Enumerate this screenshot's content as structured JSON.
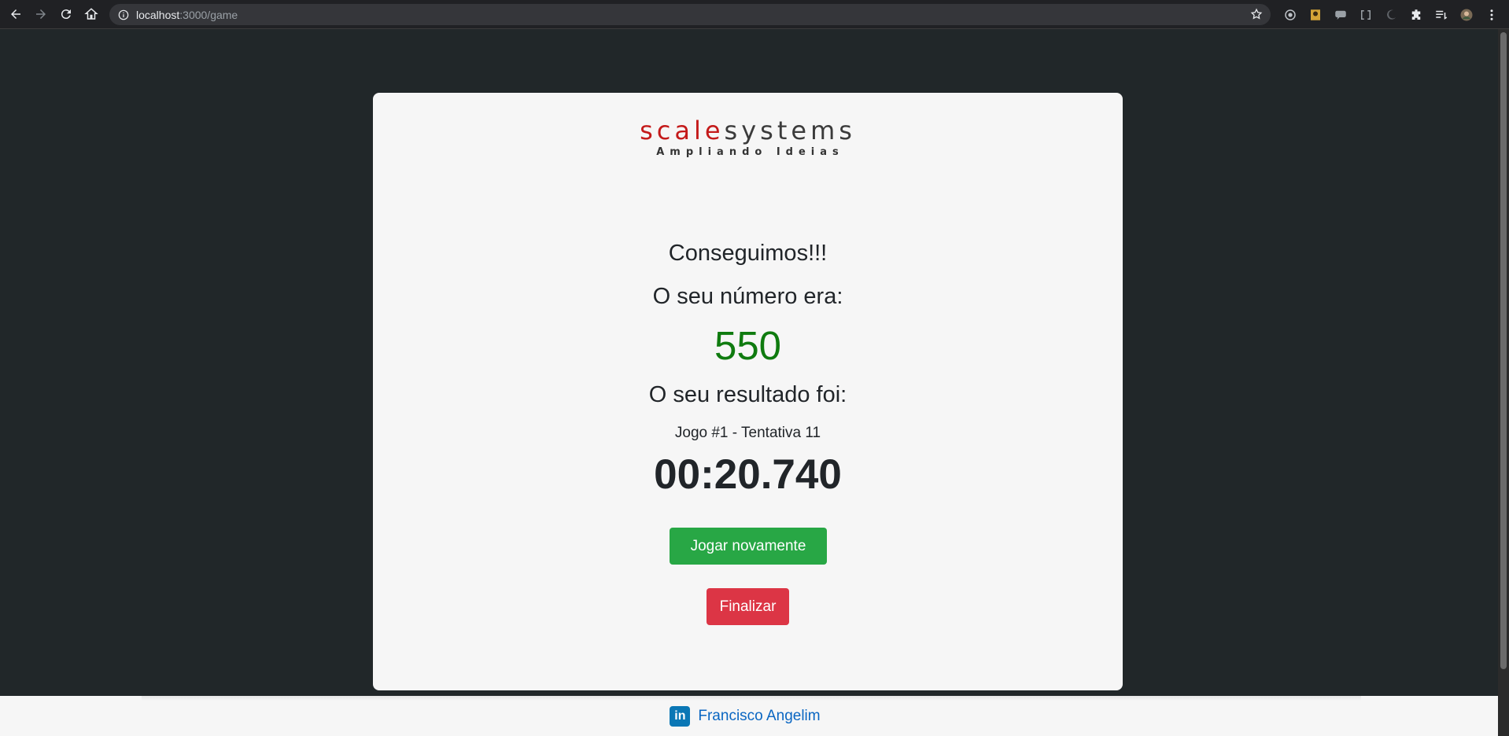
{
  "browser": {
    "url_host": "localhost",
    "url_rest": ":3000/game"
  },
  "logo": {
    "scale": "scale",
    "systems": "systems",
    "tagline": "Ampliando Ideias"
  },
  "result": {
    "success_text": "Conseguimos!!!",
    "number_label": "O seu número era:",
    "number": "550",
    "result_label": "O seu resultado foi:",
    "attempt": "Jogo #1 - Tentativa 11",
    "time": "00:20.740"
  },
  "buttons": {
    "play_again": "Jogar novamente",
    "finish": "Finalizar"
  },
  "footer": {
    "linkedin_glyph": "in",
    "author": "Francisco Angelim"
  },
  "colors": {
    "number": "#0f7b0f",
    "play_again": "#28a745",
    "finish": "#dc3545",
    "page_bg": "#212729"
  }
}
